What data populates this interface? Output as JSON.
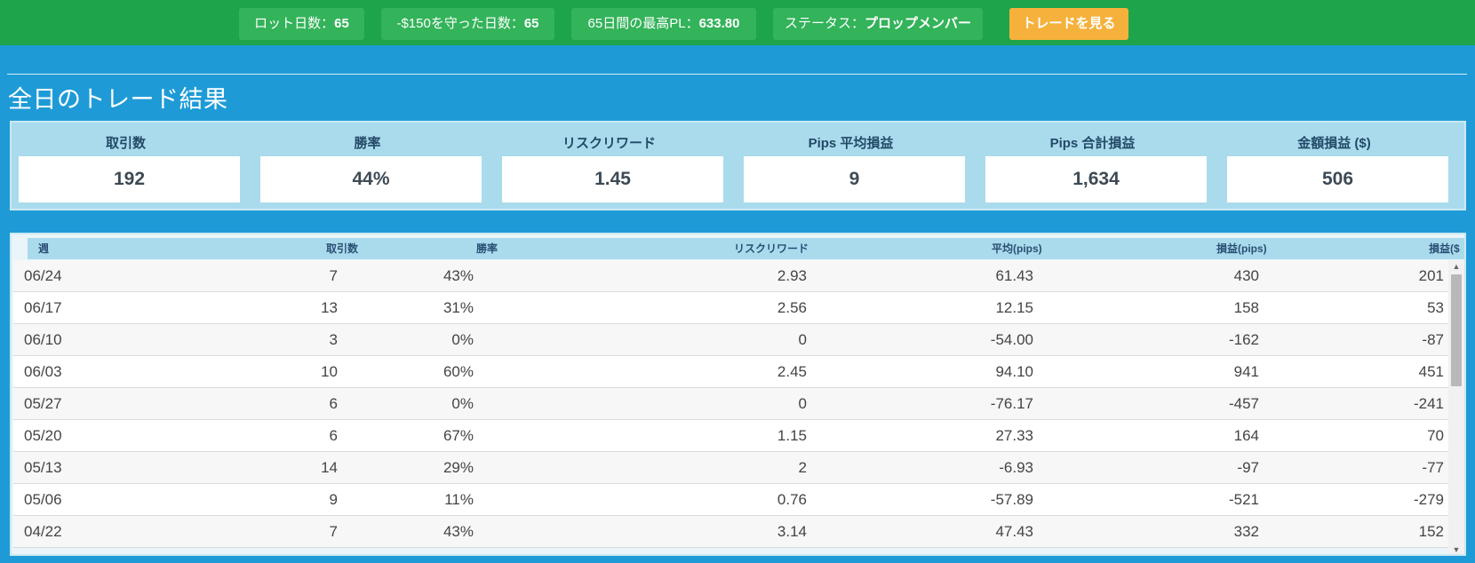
{
  "topbar": {
    "lot_days_label": "ロット日数：",
    "lot_days_value": "65",
    "protected_days_label": "-$150を守った日数：",
    "protected_days_value": "65",
    "max_pl_label": "65日間の最高PL：",
    "max_pl_value": "633.80",
    "status_label": "ステータス：",
    "status_value": "プロップメンバー",
    "view_trades_button": "トレードを見る"
  },
  "section": {
    "title": "全日のトレード結果"
  },
  "summary": [
    {
      "label": "取引数",
      "value": "192"
    },
    {
      "label": "勝率",
      "value": "44%"
    },
    {
      "label": "リスクリワード",
      "value": "1.45"
    },
    {
      "label": "Pips 平均損益",
      "value": "9"
    },
    {
      "label": "Pips 合計損益",
      "value": "1,634"
    },
    {
      "label": "金額損益 ($)",
      "value": "506"
    }
  ],
  "table": {
    "headers": [
      "週",
      "取引数",
      "勝率",
      "リスクリワード",
      "平均(pips)",
      "損益(pips)",
      "損益($"
    ],
    "rows": [
      [
        "06/24",
        "7",
        "43%",
        "2.93",
        "61.43",
        "430",
        "201"
      ],
      [
        "06/17",
        "13",
        "31%",
        "2.56",
        "12.15",
        "158",
        "53"
      ],
      [
        "06/10",
        "3",
        "0%",
        "0",
        "-54.00",
        "-162",
        "-87"
      ],
      [
        "06/03",
        "10",
        "60%",
        "2.45",
        "94.10",
        "941",
        "451"
      ],
      [
        "05/27",
        "6",
        "0%",
        "0",
        "-76.17",
        "-457",
        "-241"
      ],
      [
        "05/20",
        "6",
        "67%",
        "1.15",
        "27.33",
        "164",
        "70"
      ],
      [
        "05/13",
        "14",
        "29%",
        "2",
        "-6.93",
        "-97",
        "-77"
      ],
      [
        "05/06",
        "9",
        "11%",
        "0.76",
        "-57.89",
        "-521",
        "-279"
      ],
      [
        "04/22",
        "7",
        "43%",
        "3.14",
        "47.43",
        "332",
        "152"
      ]
    ]
  },
  "scrollbar": {
    "up_icon": "triangle-up-icon",
    "down_icon": "triangle-down-icon"
  },
  "colors": {
    "topbar": "#1ea44a",
    "background": "#1e9bd7",
    "button": "#f5b13c",
    "card_header": "#a9dbed"
  }
}
